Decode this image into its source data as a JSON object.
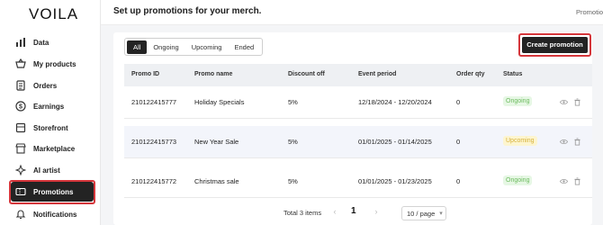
{
  "brand": {
    "logo": "VOILA"
  },
  "sidebar": {
    "items": [
      {
        "label": "Data",
        "icon": "bar-chart-icon"
      },
      {
        "label": "My products",
        "icon": "basket-icon"
      },
      {
        "label": "Orders",
        "icon": "clipboard-icon"
      },
      {
        "label": "Earnings",
        "icon": "dollar-icon"
      },
      {
        "label": "Storefront",
        "icon": "store-icon"
      },
      {
        "label": "Marketplace",
        "icon": "shop-icon"
      },
      {
        "label": "AI artist",
        "icon": "sparkle-icon"
      },
      {
        "label": "Promotions",
        "icon": "ticket-icon",
        "active": true
      },
      {
        "label": "Notifications",
        "icon": "bell-icon"
      }
    ]
  },
  "header": {
    "title": "Set up promotions for your merch.",
    "breadcrumb": "Promotio"
  },
  "filters": {
    "tabs": [
      "All",
      "Ongoing",
      "Upcoming",
      "Ended"
    ],
    "active": "All"
  },
  "actions": {
    "create_label": "Create promotion"
  },
  "table": {
    "columns": [
      "Promo ID",
      "Promo name",
      "Discount off",
      "Event period",
      "Order qty",
      "Status"
    ],
    "rows": [
      {
        "id": "210122415777",
        "name": "Holiday Specials",
        "discount": "5%",
        "period": "12/18/2024 - 12/20/2024",
        "qty": "0",
        "status": "Ongoing"
      },
      {
        "id": "210122415773",
        "name": "New Year Sale",
        "discount": "5%",
        "period": "01/01/2025 - 01/14/2025",
        "qty": "0",
        "status": "Upcoming"
      },
      {
        "id": "210122415772",
        "name": "Christmas sale",
        "discount": "5%",
        "period": "01/01/2025 - 01/23/2025",
        "qty": "0",
        "status": "Ongoing"
      }
    ]
  },
  "pagination": {
    "total": "Total 3 items",
    "current": "1",
    "page_size": "10 / page"
  },
  "colors": {
    "accent": "#232323",
    "highlight": "#d5363b",
    "ongoing": "#6dbb5f",
    "upcoming": "#d7b23d"
  }
}
